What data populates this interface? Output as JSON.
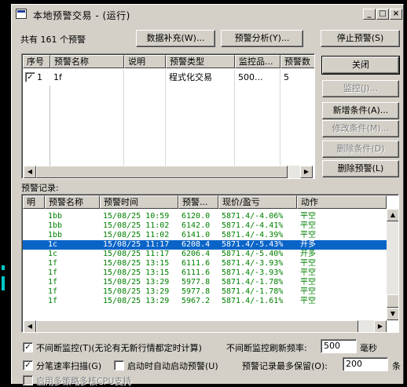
{
  "window": {
    "title": "本地预警交易 - (运行)",
    "minimize_glyph": "_",
    "maximize_glyph": "□",
    "close_glyph": "×"
  },
  "summary": {
    "text": "共有 161 个预警"
  },
  "toolbar": {
    "data_fill": "数据补充(W)...",
    "alert_analysis": "预警分析(Y)...",
    "stop_alert": "停止预警(S)"
  },
  "side_buttons": {
    "close": "关闭",
    "monitor": "监控(J)...",
    "add_condition": "新增条件(A)...",
    "modify_condition": "修改条件(M)...",
    "delete_condition": "删除条件(D)",
    "delete_alert": "删除预警(L)"
  },
  "alert_table": {
    "columns": [
      "序号",
      "预警名称",
      "说明",
      "预警类型",
      "监控品...",
      "预警数"
    ],
    "rows": [
      {
        "checked": true,
        "index": "1",
        "name": "1f",
        "desc": "",
        "type": "程式化交易",
        "monitor": "500...",
        "count": "5"
      }
    ]
  },
  "log": {
    "label": "预警记录:",
    "columns": [
      "明",
      "预警名称",
      "预警时间",
      "预警...",
      "现价/盈亏",
      "动作"
    ],
    "rows": [
      {
        "name": "1bb",
        "time": "15/08/25 10:59",
        "price": "6120.0",
        "pnl": "5871.4/-4.06%",
        "action": "平空",
        "selected": false
      },
      {
        "name": "1bb",
        "time": "15/08/25 11:02",
        "price": "6142.0",
        "pnl": "5871.4/-4.41%",
        "action": "平空",
        "selected": false
      },
      {
        "name": "1bb",
        "time": "15/08/25 11:02",
        "price": "6141.0",
        "pnl": "5871.4/-4.39%",
        "action": "平空",
        "selected": false
      },
      {
        "name": "1c",
        "time": "15/08/25 11:17",
        "price": "6208.4",
        "pnl": "5871.4/-5.43%",
        "action": "开多",
        "selected": true
      },
      {
        "name": "1c",
        "time": "15/08/25 11:17",
        "price": "6206.4",
        "pnl": "5871.4/-5.40%",
        "action": "开多",
        "selected": false
      },
      {
        "name": "1f",
        "time": "15/08/25 13:15",
        "price": "6111.6",
        "pnl": "5871.4/-3.93%",
        "action": "平空",
        "selected": false
      },
      {
        "name": "1f",
        "time": "15/08/25 13:15",
        "price": "6111.6",
        "pnl": "5871.4/-3.93%",
        "action": "平空",
        "selected": false
      },
      {
        "name": "1f",
        "time": "15/08/25 13:29",
        "price": "5977.8",
        "pnl": "5871.4/-1.78%",
        "action": "平空",
        "selected": false
      },
      {
        "name": "1f",
        "time": "15/08/25 13:29",
        "price": "5977.8",
        "pnl": "5871.4/-1.78%",
        "action": "平空",
        "selected": false
      },
      {
        "name": "1f",
        "time": "15/08/25 13:29",
        "price": "5967.2",
        "pnl": "5871.4/-1.61%",
        "action": "平空",
        "selected": false
      }
    ]
  },
  "options": {
    "continuous_monitor": "不间断监控(T)(无论有无新行情都定时计算)",
    "refresh_label": "不间断监控刷新频率:",
    "refresh_value": "500",
    "refresh_unit": "毫秒",
    "tick_scan": "分笔速率扫描(G)",
    "auto_start": "启动时自动启动预警(U)",
    "keep_label": "预警记录最多保留(O):",
    "keep_value": "200",
    "keep_unit": "条",
    "multicore": "启用多策略多核CPU支持"
  },
  "colors": {
    "log_text": "#008000",
    "selection": "#0a64c8",
    "face": "#d4d0c8"
  }
}
